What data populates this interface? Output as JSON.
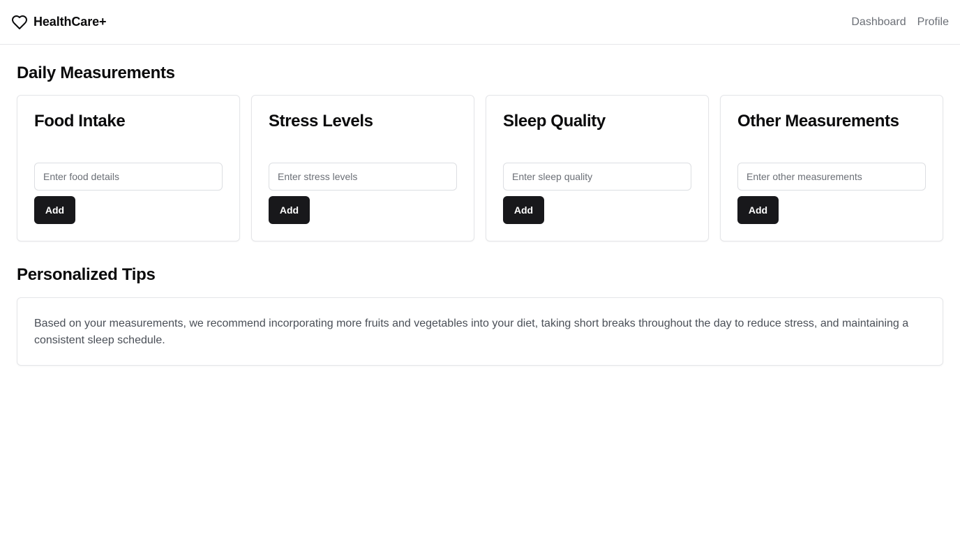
{
  "header": {
    "brand": "HealthCare+",
    "brand_icon": "heart-icon",
    "nav": [
      {
        "label": "Dashboard"
      },
      {
        "label": "Profile"
      }
    ]
  },
  "daily": {
    "title": "Daily Measurements",
    "cards": [
      {
        "title": "Food Intake",
        "placeholder": "Enter food details",
        "button": "Add"
      },
      {
        "title": "Stress Levels",
        "placeholder": "Enter stress levels",
        "button": "Add"
      },
      {
        "title": "Sleep Quality",
        "placeholder": "Enter sleep quality",
        "button": "Add"
      },
      {
        "title": "Other Measurements",
        "placeholder": "Enter other measurements",
        "button": "Add"
      }
    ]
  },
  "tips": {
    "title": "Personalized Tips",
    "text": "Based on your measurements, we recommend incorporating more fruits and vegetables into your diet, taking short breaks throughout the day to reduce stress, and maintaining a consistent sleep schedule."
  },
  "colors": {
    "button_bg": "#18181b",
    "border": "#e4e5e8",
    "muted_text": "#6b6f76"
  }
}
